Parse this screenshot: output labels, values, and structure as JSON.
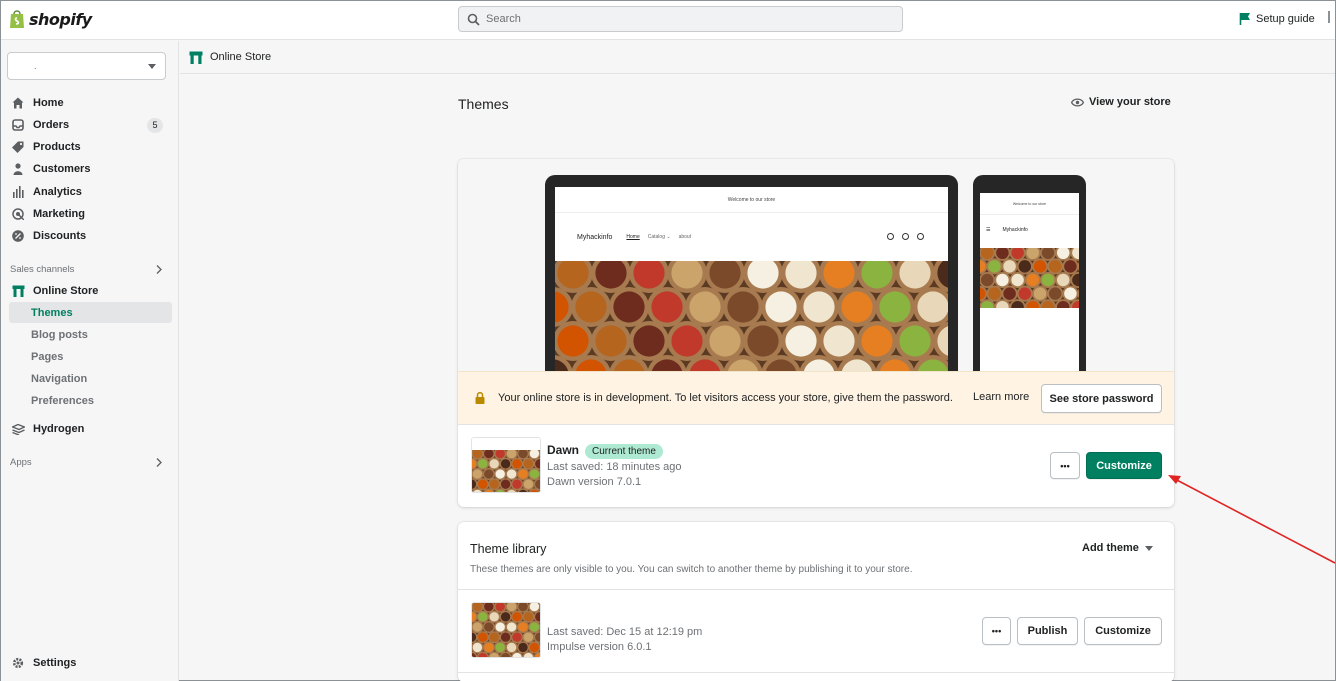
{
  "topbar": {
    "logo_text": "shopify",
    "search_placeholder": "Search",
    "setup_guide": "Setup guide"
  },
  "sidebar": {
    "store_name": ".",
    "main_items": [
      {
        "label": "Home",
        "icon": "home-icon"
      },
      {
        "label": "Orders",
        "icon": "orders-icon",
        "badge": "5"
      },
      {
        "label": "Products",
        "icon": "tag-icon"
      },
      {
        "label": "Customers",
        "icon": "person-icon"
      },
      {
        "label": "Analytics",
        "icon": "bar-chart-icon"
      },
      {
        "label": "Marketing",
        "icon": "target-icon"
      },
      {
        "label": "Discounts",
        "icon": "discount-icon"
      }
    ],
    "sales_channels_label": "Sales channels",
    "online_store": "Online Store",
    "online_store_sub": [
      "Themes",
      "Blog posts",
      "Pages",
      "Navigation",
      "Preferences"
    ],
    "hydrogen": "Hydrogen",
    "apps_label": "Apps",
    "settings": "Settings"
  },
  "breadcrumb": {
    "label": "Online Store"
  },
  "page": {
    "title": "Themes",
    "view_store": "View your store"
  },
  "preview": {
    "announcement": "Welcome to our store",
    "store_name": "Myhackinfo",
    "nav": [
      "Home",
      "Catalog ⌄",
      "about"
    ]
  },
  "dev_banner": {
    "message": "Your online store is in development. To let visitors access your store, give them the password.",
    "learn_more": "Learn more",
    "button": "See store password"
  },
  "current_theme": {
    "name": "Dawn",
    "badge": "Current theme",
    "last_saved": "Last saved: 18 minutes ago",
    "version": "Dawn version 7.0.1",
    "more_button": "•••",
    "customize_button": "Customize"
  },
  "theme_library": {
    "title": "Theme library",
    "subtitle": "These themes are only visible to you. You can switch to another theme by publishing it to your store.",
    "add_theme": "Add theme",
    "items": [
      {
        "last_saved": "Last saved: Dec 15 at 12:19 pm",
        "version": "Impulse version 6.0.1",
        "more_button": "•••",
        "publish_button": "Publish",
        "customize_button": "Customize"
      }
    ]
  },
  "colors": {
    "primary": "#008060",
    "annotation_arrow": "#e02424",
    "banner": "#fff4e4",
    "badge_green": "#aee9d1"
  }
}
